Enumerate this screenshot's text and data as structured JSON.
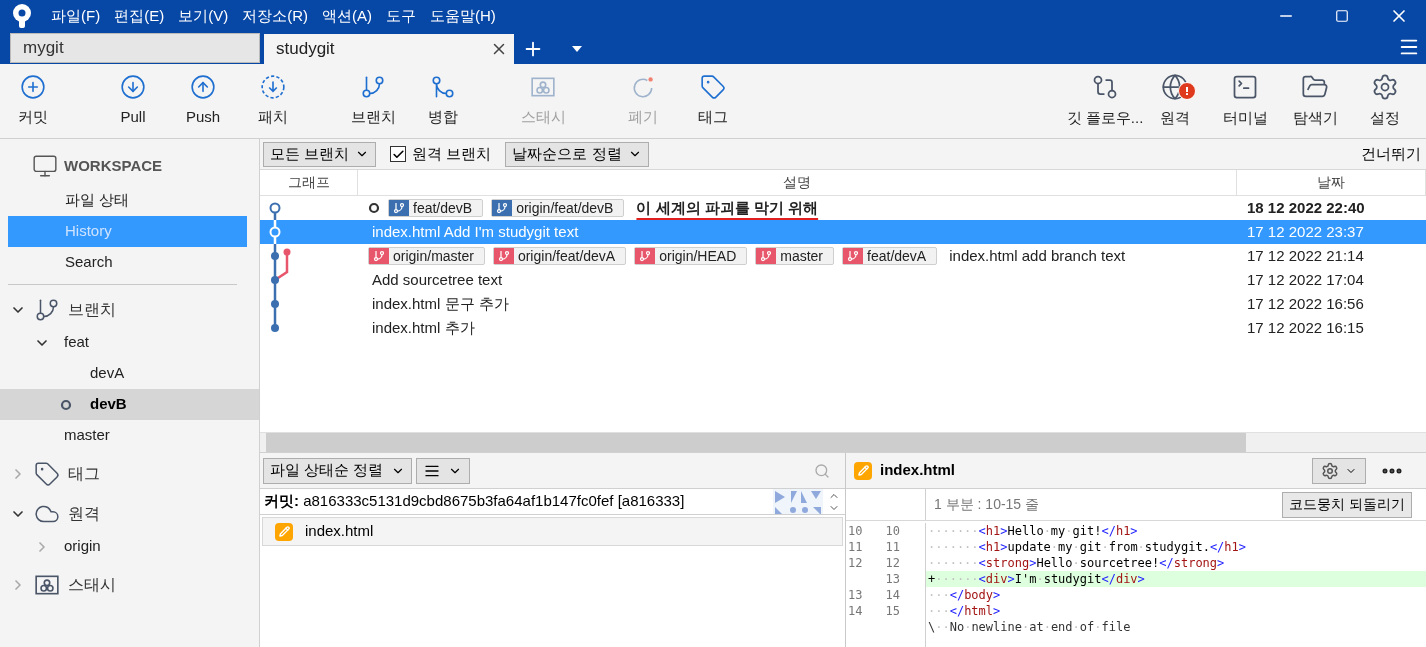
{
  "menu": [
    "파일(F)",
    "편집(E)",
    "보기(V)",
    "저장소(R)",
    "액션(A)",
    "도구",
    "도움말(H)"
  ],
  "tabs": [
    {
      "label": "mygit",
      "selected": false
    },
    {
      "label": "studygit",
      "selected": true
    }
  ],
  "toolbar": {
    "left": [
      [
        {
          "kind": "commit",
          "label": "커밋",
          "disabled": false
        }
      ],
      [
        {
          "kind": "pull",
          "label": "Pull",
          "disabled": false
        },
        {
          "kind": "push",
          "label": "Push",
          "disabled": false
        },
        {
          "kind": "patch",
          "label": "패치",
          "disabled": false
        }
      ],
      [
        {
          "kind": "branch",
          "label": "브랜치",
          "disabled": false
        },
        {
          "kind": "merge",
          "label": "병합",
          "disabled": false
        }
      ],
      [
        {
          "kind": "stash",
          "label": "스태시",
          "disabled": true
        }
      ],
      [
        {
          "kind": "discard",
          "label": "폐기",
          "disabled": true
        },
        {
          "kind": "tag",
          "label": "태그",
          "disabled": false
        }
      ]
    ],
    "right": [
      {
        "kind": "gitflow",
        "label": "깃 플로우...",
        "disabled": false,
        "alert": false
      },
      {
        "kind": "remote",
        "label": "원격",
        "disabled": false,
        "alert": true
      },
      {
        "kind": "terminal",
        "label": "터미널",
        "disabled": false,
        "alert": false
      },
      {
        "kind": "explorer",
        "label": "탐색기",
        "disabled": false,
        "alert": false
      },
      {
        "kind": "settings",
        "label": "설정",
        "disabled": false,
        "alert": false
      }
    ]
  },
  "sidebar": {
    "workspace": {
      "title": "WORKSPACE",
      "items": [
        {
          "label": "파일 상태",
          "selected": false
        },
        {
          "label": "History",
          "selected": true
        },
        {
          "label": "Search",
          "selected": false
        }
      ]
    },
    "sections": [
      {
        "kind": "branches",
        "label": "브랜치",
        "expanded": true,
        "children": [
          {
            "label": "feat",
            "expanded": true,
            "children": [
              {
                "label": "devA",
                "current": false,
                "selected": false
              },
              {
                "label": "devB",
                "current": true,
                "selected": true
              }
            ]
          },
          {
            "label": "master",
            "current": false,
            "selected": false
          }
        ]
      },
      {
        "kind": "tags",
        "label": "태그",
        "expanded": false
      },
      {
        "kind": "remotes",
        "label": "원격",
        "expanded": true,
        "children": [
          {
            "label": "origin",
            "expanded": false
          }
        ]
      },
      {
        "kind": "stashes",
        "label": "스태시",
        "expanded": false
      }
    ]
  },
  "filters": {
    "branches": "모든 브랜치",
    "remote_branches": {
      "label": "원격 브랜치",
      "checked": true
    },
    "sort": "날짜순으로 정렬",
    "jump": "건너뛰기"
  },
  "history": {
    "columns": [
      "그래프",
      "설명",
      "날짜"
    ],
    "rows": [
      {
        "head": true,
        "selected": false,
        "underline": true,
        "refs": [
          {
            "label": "feat/devB",
            "color": "#3b6fb0"
          },
          {
            "label": "origin/feat/devB",
            "color": "#3b6fb0"
          }
        ],
        "message": "이 세계의 파괴를 막기 위해",
        "date": "18 12 2022 22:40"
      },
      {
        "head": false,
        "selected": true,
        "underline": false,
        "message": "index.html Add I'm studygit text",
        "date": "17 12 2022 23:37"
      },
      {
        "head": false,
        "selected": false,
        "underline": false,
        "refs": [
          {
            "label": "origin/master",
            "color": "#e8566c"
          },
          {
            "label": "origin/feat/devA",
            "color": "#e8566c"
          },
          {
            "label": "origin/HEAD",
            "color": "#e8566c"
          },
          {
            "label": "master",
            "color": "#e8566c"
          },
          {
            "label": "feat/devA",
            "color": "#e8566c"
          }
        ],
        "message": "index.html add branch text",
        "date": "17 12 2022 21:14"
      },
      {
        "head": false,
        "selected": false,
        "underline": false,
        "message": "Add sourcetree text",
        "date": "17 12 2022 17:04"
      },
      {
        "head": false,
        "selected": false,
        "underline": false,
        "message": "index.html 문구 추가",
        "date": "17 12 2022 16:56"
      },
      {
        "head": false,
        "selected": false,
        "underline": false,
        "message": "index.html 추가",
        "date": "17 12 2022 16:15"
      }
    ]
  },
  "files_panel": {
    "sort": "파일 상태순 정렬",
    "commit_label": "커밋:",
    "commit_hash": "a816333c5131d9cbd8675b3fa64af1b147fc0fef [a816333]",
    "files": [
      {
        "name": "index.html",
        "selected": true
      }
    ]
  },
  "diff": {
    "file": "index.html",
    "hunk": "1 부분 : 10-15 줄",
    "revert": "코드뭉치 되돌리기",
    "lines": [
      {
        "kind": "context",
        "old": "10",
        "new": "10",
        "text": "·······<h1>Hello·my·git!</h1>"
      },
      {
        "kind": "context",
        "old": "11",
        "new": "11",
        "text": "·······<h1>update·my·git·from·studygit.</h1>"
      },
      {
        "kind": "context",
        "old": "12",
        "new": "12",
        "text": "·······<strong>Hello·sourcetree!</strong>"
      },
      {
        "kind": "added",
        "new": "13",
        "text": "+······<div>I'm·studygit</div>"
      },
      {
        "kind": "context",
        "old": "13",
        "new": "14",
        "text": "···</body>"
      },
      {
        "kind": "context",
        "old": "14",
        "new": "15",
        "text": "···</html>"
      },
      {
        "kind": "note",
        "text": "\\··No·newline·at·end·of·file"
      }
    ]
  }
}
